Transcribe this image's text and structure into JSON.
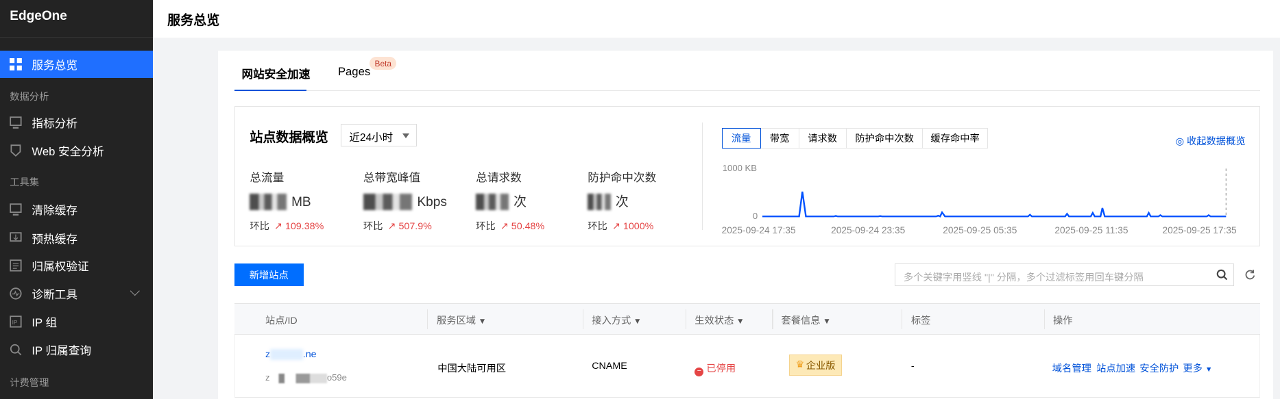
{
  "sidebar": {
    "brand": "EdgeOne",
    "items": [
      {
        "label": "服务总览",
        "icon": "grid-icon"
      },
      {
        "section": "数据分析"
      },
      {
        "label": "指标分析",
        "icon": "monitor-chart-icon"
      },
      {
        "label": "Web 安全分析",
        "icon": "shield-icon"
      },
      {
        "section": "工具集"
      },
      {
        "label": "清除缓存",
        "icon": "purge-icon"
      },
      {
        "label": "预热缓存",
        "icon": "prefetch-icon"
      },
      {
        "label": "归属权验证",
        "icon": "verify-icon"
      },
      {
        "label": "诊断工具",
        "icon": "diagnose-icon"
      },
      {
        "label": "IP 组",
        "icon": "ip-icon"
      },
      {
        "label": "IP 归属查询",
        "icon": "search-icon"
      },
      {
        "section": "计费管理"
      }
    ]
  },
  "header": {
    "title": "服务总览"
  },
  "tabs": [
    {
      "label": "网站安全加速"
    },
    {
      "label": "Pages",
      "badge": "Beta"
    }
  ],
  "overview": {
    "title": "站点数据概览",
    "range": "近24小时",
    "metrics": [
      {
        "label": "总流量",
        "unit": "MB",
        "cmp_label": "环比",
        "cmp": "109.38%"
      },
      {
        "label": "总带宽峰值",
        "unit": "Kbps",
        "cmp_label": "环比",
        "cmp": "507.9%"
      },
      {
        "label": "总请求数",
        "unit": "次",
        "cmp_label": "环比",
        "cmp": "50.48%"
      },
      {
        "label": "防护命中次数",
        "unit": "次",
        "cmp_label": "环比",
        "cmp": "1000%"
      }
    ],
    "chart_tabs": [
      "流量",
      "带宽",
      "请求数",
      "防护命中次数",
      "缓存命中率"
    ],
    "collapse": "收起数据概览",
    "accent": "#0052d9"
  },
  "chart_data": {
    "type": "line",
    "ylabel_top": "1000 KB",
    "ylabel_zero": "0",
    "ylim": [
      0,
      1000
    ],
    "xlim_hours": [
      0,
      24
    ],
    "x_tick_labels": [
      "2025-09-24 17:35",
      "2025-09-24 23:35",
      "2025-09-25 05:35",
      "2025-09-25 11:35",
      "2025-09-25 17:35"
    ],
    "series": [
      {
        "name": "流量",
        "unit": "KB",
        "points": [
          [
            0,
            5
          ],
          [
            1.9,
            5
          ],
          [
            2.07,
            520
          ],
          [
            2.25,
            5
          ],
          [
            3.7,
            5
          ],
          [
            3.8,
            15
          ],
          [
            3.9,
            5
          ],
          [
            6.0,
            5
          ],
          [
            6.1,
            12
          ],
          [
            6.2,
            5
          ],
          [
            9.0,
            5
          ],
          [
            9.1,
            20
          ],
          [
            9.2,
            5
          ],
          [
            9.3,
            90
          ],
          [
            9.45,
            5
          ],
          [
            13.75,
            5
          ],
          [
            13.85,
            40
          ],
          [
            13.95,
            5
          ],
          [
            15.67,
            5
          ],
          [
            15.77,
            60
          ],
          [
            15.87,
            5
          ],
          [
            17.0,
            5
          ],
          [
            17.1,
            80
          ],
          [
            17.2,
            5
          ],
          [
            17.5,
            5
          ],
          [
            17.6,
            180
          ],
          [
            17.72,
            5
          ],
          [
            19.9,
            5
          ],
          [
            20.0,
            80
          ],
          [
            20.1,
            5
          ],
          [
            20.5,
            5
          ],
          [
            20.6,
            30
          ],
          [
            20.7,
            5
          ],
          [
            23.0,
            5
          ],
          [
            23.1,
            30
          ],
          [
            23.2,
            5
          ],
          [
            24,
            5
          ]
        ]
      }
    ]
  },
  "toolbar": {
    "add_site": "新增站点",
    "search_placeholder": "多个关键字用竖线 \"|\" 分隔，多个过滤标签用回车键分隔"
  },
  "table": {
    "columns": [
      "站点/ID",
      "服务区域",
      "接入方式",
      "生效状态",
      "套餐信息",
      "标签",
      "操作"
    ],
    "rows": [
      {
        "site_prefix": "z",
        "site_suffix": ".ne",
        "id_prefix": "z",
        "id_suffix": "o59e",
        "region": "中国大陆可用区",
        "access": "CNAME",
        "status": "已停用",
        "plan": "企业版",
        "tags": "-",
        "actions": [
          "域名管理",
          "站点加速",
          "安全防护",
          "更多"
        ]
      }
    ]
  }
}
